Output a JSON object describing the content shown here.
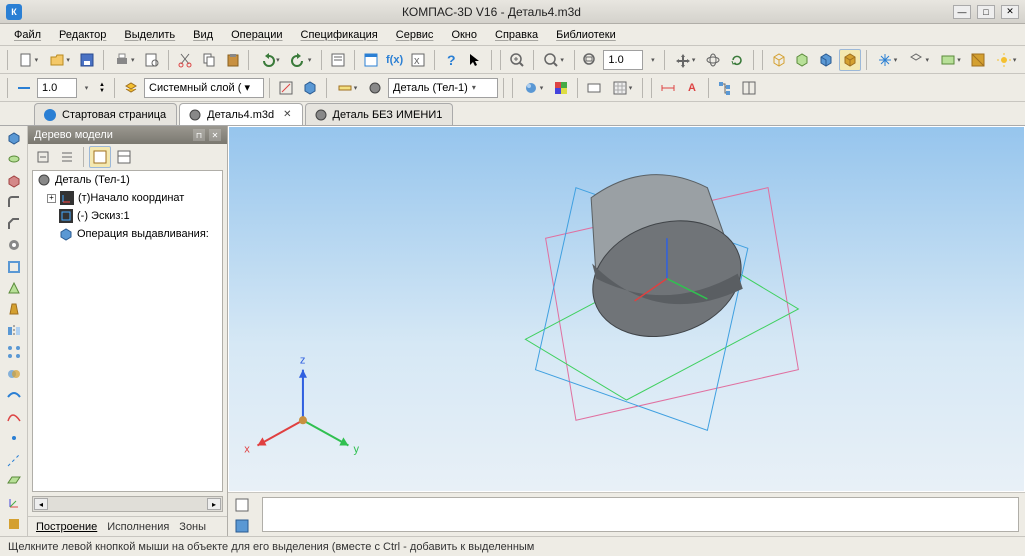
{
  "window": {
    "title": "КОМПАС-3D V16  -  Деталь4.m3d",
    "app_badge": "К"
  },
  "menu": [
    "Файл",
    "Редактор",
    "Выделить",
    "Вид",
    "Операции",
    "Спецификация",
    "Сервис",
    "Окно",
    "Справка",
    "Библиотеки"
  ],
  "toolbar1": {
    "zoom_value": "1.0"
  },
  "toolbar2": {
    "scale_value": "1.0",
    "layer_label": "Системный слой ( ▾",
    "body_label": "Деталь (Тел-1)"
  },
  "tabs": [
    {
      "label": "Стартовая страница",
      "active": false,
      "icon_color": "#2a7fd4",
      "closeable": false
    },
    {
      "label": "Деталь4.m3d",
      "active": true,
      "icon_color": "#777",
      "closeable": true
    },
    {
      "label": "Деталь БЕЗ ИМЕНИ1",
      "active": false,
      "icon_color": "#777",
      "closeable": false
    }
  ],
  "side_panel": {
    "title": "Дерево модели",
    "root": "Деталь (Тел-1)",
    "children": [
      {
        "label": "(т)Начало координат",
        "expandable": true
      },
      {
        "label": "(-) Эскиз:1",
        "expandable": false
      },
      {
        "label": "Операция выдавливания:",
        "expandable": false
      }
    ],
    "tabs": [
      "Построение",
      "Исполнения",
      "Зоны"
    ],
    "active_tab": 0
  },
  "axis_labels": {
    "x": "x",
    "y": "y",
    "z": "z"
  },
  "statusbar": {
    "text": "Щелкните левой кнопкой мыши на объекте для его выделения (вместе с Ctrl - добавить к выделенным"
  },
  "icons": {
    "new": "new-doc-icon",
    "open": "open-icon",
    "save": "save-icon",
    "print": "print-icon",
    "preview": "preview-icon",
    "cut": "cut-icon",
    "copy": "copy-icon",
    "paste": "paste-icon",
    "undo": "undo-icon",
    "redo": "redo-icon",
    "props": "properties-icon",
    "spec": "spec-icon",
    "fx": "function-icon",
    "vars": "vars-icon",
    "help": "help-icon",
    "cursor": "cursor-icon",
    "zoom_in": "zoom-in-icon",
    "zoom_fit": "zoom-fit-icon",
    "zoom_window": "zoom-window-icon",
    "pan": "pan-icon",
    "rotate": "rotate-view-icon",
    "cube": "cube-icon",
    "ortho": "ortho-icon",
    "section": "section-icon",
    "render": "render-icon"
  }
}
